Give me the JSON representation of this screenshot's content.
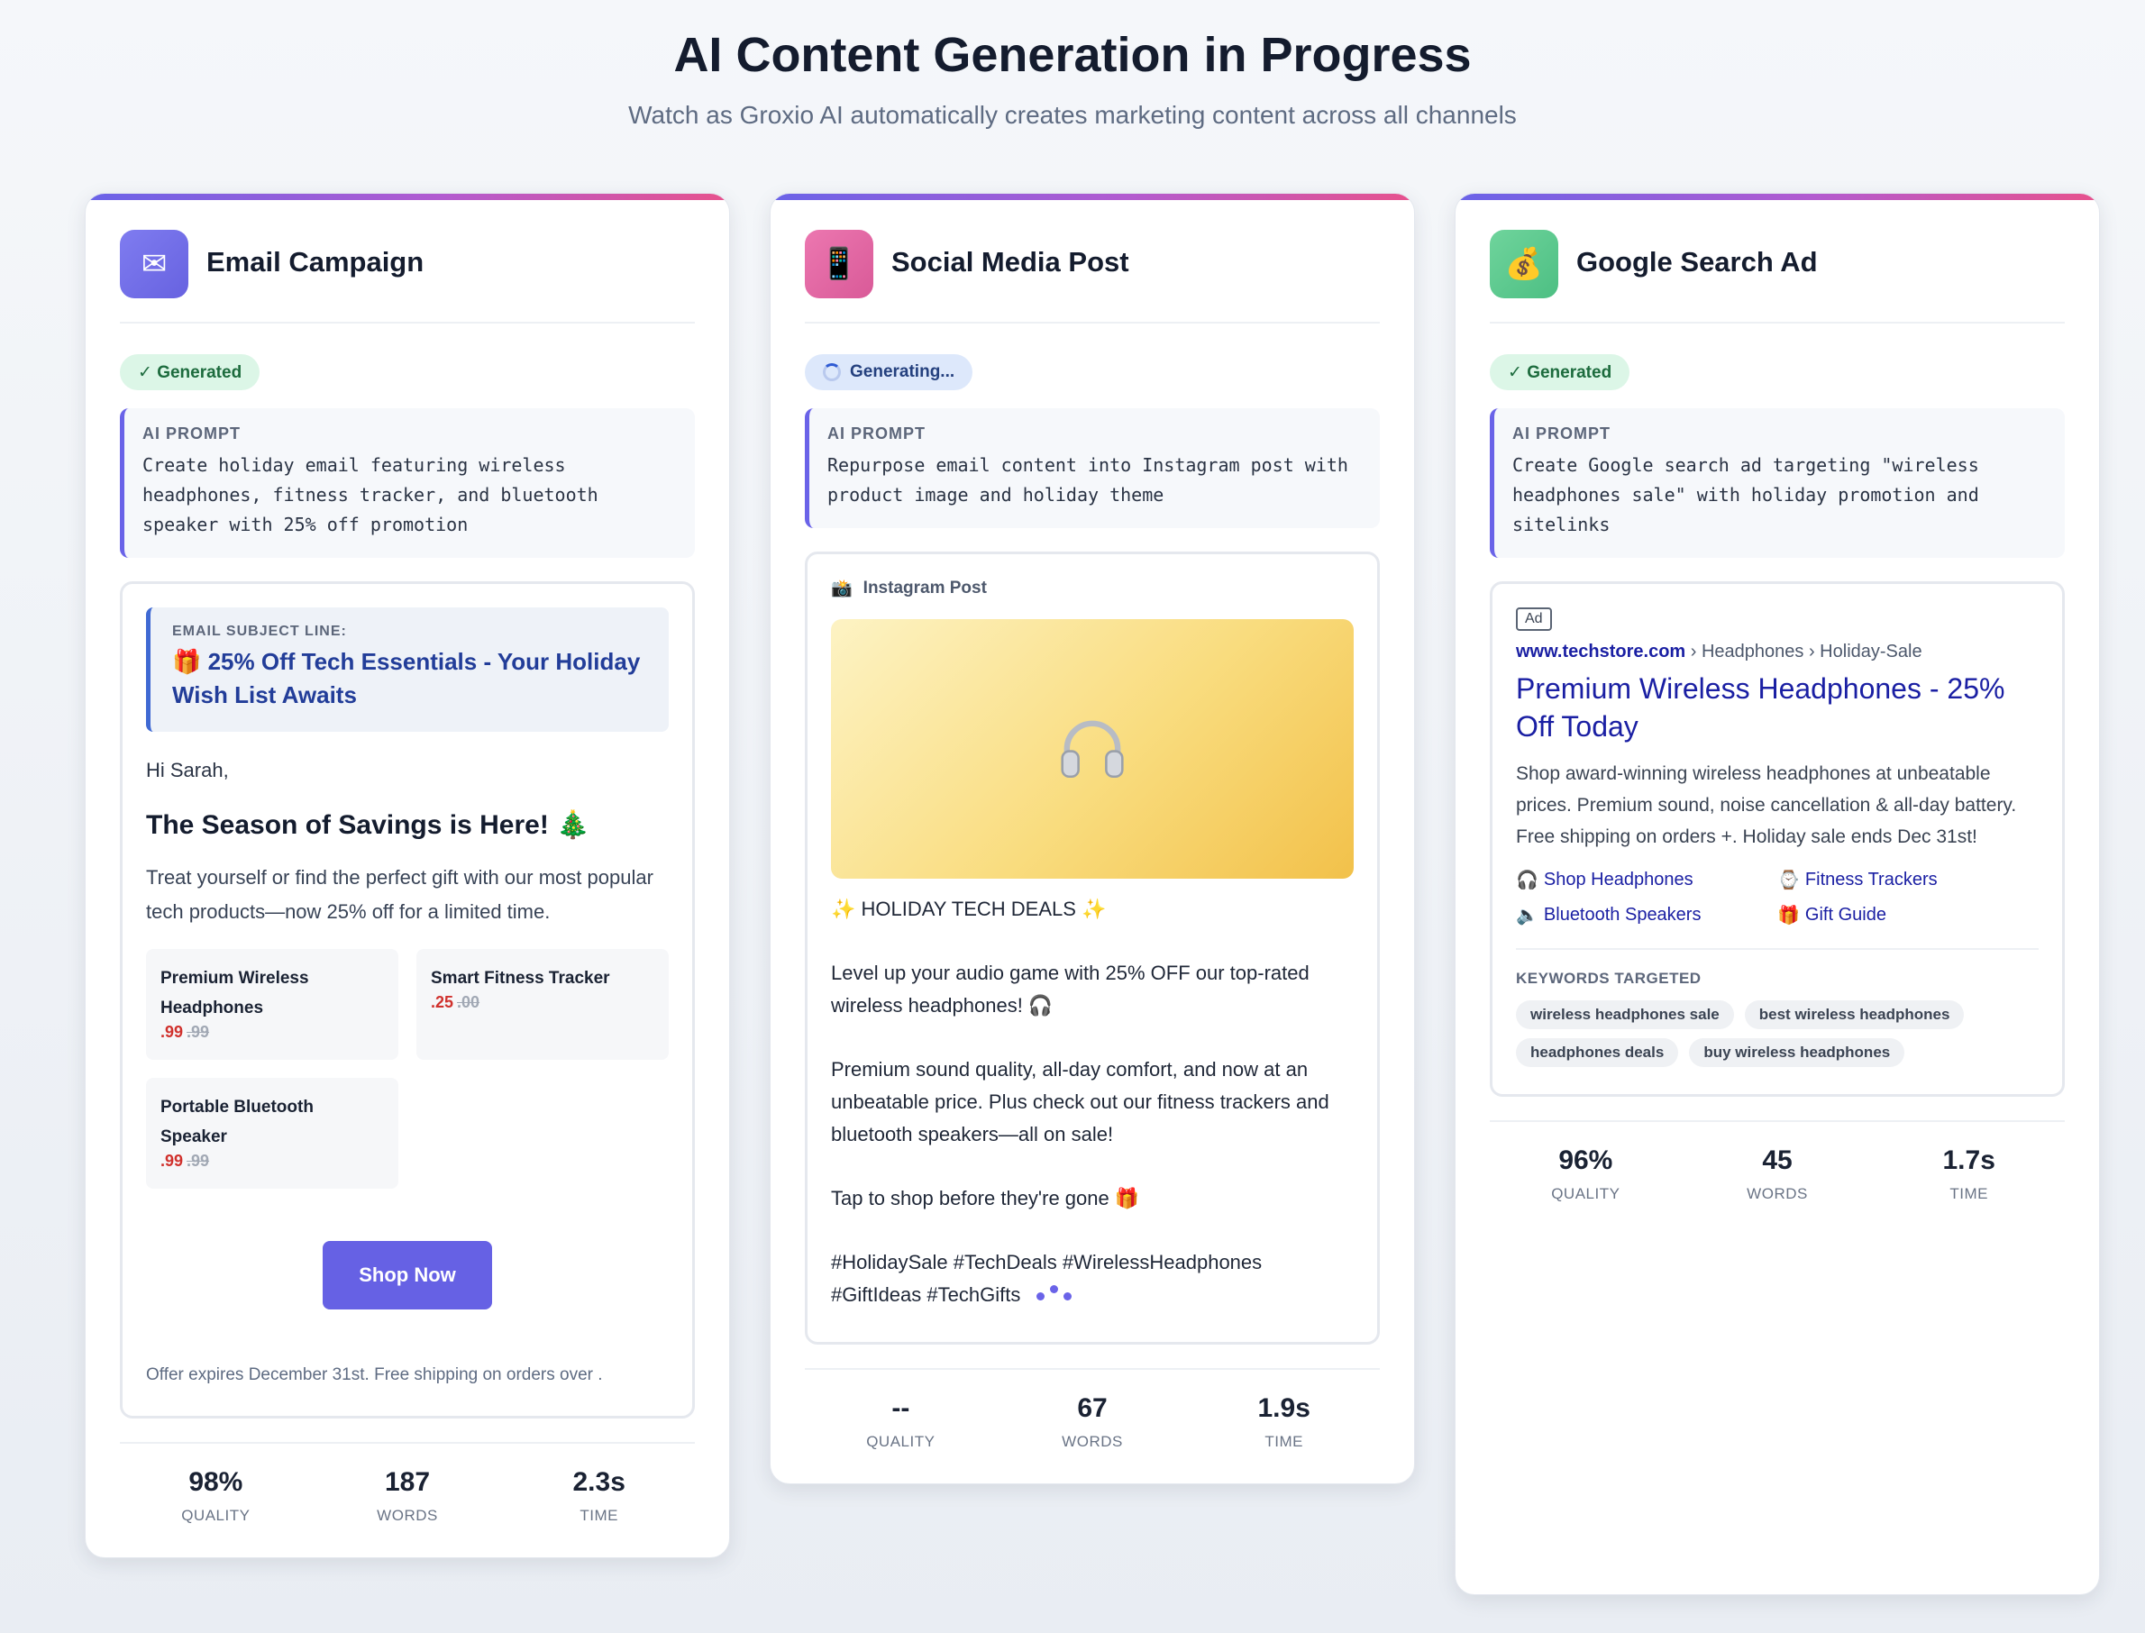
{
  "header": {
    "title": "AI Content Generation in Progress",
    "subtitle": "Watch as Groxio AI automatically creates marketing content across all channels"
  },
  "email": {
    "title": "Email Campaign",
    "icon": "✉",
    "status": "✓ Generated",
    "prompt_label": "AI PROMPT",
    "prompt": "Create holiday email featuring wireless headphones, fitness tracker, and bluetooth speaker with 25% off promotion",
    "subject_label": "EMAIL SUBJECT LINE:",
    "subject": "🎁 25% Off Tech Essentials - Your Holiday Wish List Awaits",
    "greeting": "Hi Sarah,",
    "heading": "The Season of Savings is Here! 🎄",
    "body": "Treat yourself or find the perfect gift with our most popular tech products—now 25% off for a limited time.",
    "products": [
      {
        "name": "Premium Wireless Headphones",
        "price": ".99",
        "old_price": ".99"
      },
      {
        "name": "Smart Fitness Tracker",
        "price": ".25",
        "old_price": ".00"
      },
      {
        "name": "Portable Bluetooth Speaker",
        "price": ".99",
        "old_price": ".99"
      }
    ],
    "cta": "Shop Now",
    "footer": "Offer expires December 31st. Free shipping on orders over .",
    "stats": [
      {
        "value": "98%",
        "label": "QUALITY"
      },
      {
        "value": "187",
        "label": "WORDS"
      },
      {
        "value": "2.3s",
        "label": "TIME"
      }
    ]
  },
  "social": {
    "title": "Social Media Post",
    "icon": "📱",
    "status": "Generating...",
    "prompt_label": "AI PROMPT",
    "prompt": "Repurpose email content into Instagram post with product image and holiday theme",
    "post_label": "Instagram Post",
    "post_label_icon": "📸",
    "image_icon": "🎧",
    "lines": [
      "✨ HOLIDAY TECH DEALS ✨",
      "Level up your audio game with 25% OFF our top-rated wireless headphones! 🎧",
      "Premium sound quality, all-day comfort, and now at an unbeatable price. Plus check out our fitness trackers and bluetooth speakers—all on sale!",
      "Tap to shop before they're gone 🎁",
      "#HolidaySale #TechDeals #WirelessHeadphones #GiftIdeas #TechGifts"
    ],
    "stats": [
      {
        "value": "--",
        "label": "QUALITY"
      },
      {
        "value": "67",
        "label": "WORDS"
      },
      {
        "value": "1.9s",
        "label": "TIME"
      }
    ]
  },
  "ad": {
    "title": "Google Search Ad",
    "icon": "💰",
    "status": "✓ Generated",
    "prompt_label": "AI PROMPT",
    "prompt": "Create Google search ad targeting \"wireless headphones sale\" with holiday promotion and sitelinks",
    "ad_tag": "Ad",
    "domain": "www.techstore.com",
    "path": " › Headphones › Holiday-Sale",
    "headline": "Premium Wireless Headphones - 25% Off Today",
    "description": "Shop award-winning wireless headphones at unbeatable prices. Premium sound, noise cancellation & all-day battery. Free shipping on orders +. Holiday sale ends Dec 31st!",
    "sitelinks": [
      {
        "icon": "🎧",
        "label": "Shop Headphones"
      },
      {
        "icon": "⌚",
        "label": "Fitness Trackers"
      },
      {
        "icon": "🔈",
        "label": "Bluetooth Speakers"
      },
      {
        "icon": "🎁",
        "label": "Gift Guide"
      }
    ],
    "keywords_label": "KEYWORDS TARGETED",
    "keywords": [
      "wireless headphones sale",
      "best wireless headphones",
      "headphones deals",
      "buy wireless headphones"
    ],
    "stats": [
      {
        "value": "96%",
        "label": "QUALITY"
      },
      {
        "value": "45",
        "label": "WORDS"
      },
      {
        "value": "1.7s",
        "label": "TIME"
      }
    ]
  },
  "colors": {
    "accent": "#6661e4",
    "email_icon_bg": "#7b78ec",
    "social_icon_bg": "#e46aa6",
    "ad_icon_bg": "#5cc98f",
    "price_red": "#d0312d",
    "link_blue": "#1a1fa3"
  }
}
